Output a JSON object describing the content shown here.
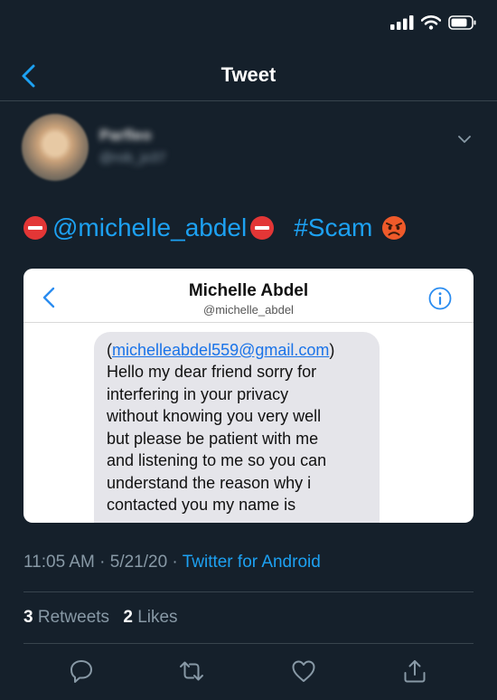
{
  "nav": {
    "title": "Tweet"
  },
  "tweet": {
    "mention": "@michelle_abdel",
    "hashtag": "#Scam",
    "timestamp": "11:05 AM · 5/21/20 · ",
    "source": "Twitter for Android",
    "retweets": {
      "count": "3",
      "label": " Retweets"
    },
    "likes": {
      "count": "2",
      "label": " Likes"
    }
  },
  "embed": {
    "name": "Michelle Abdel",
    "handle": "@michelle_abdel",
    "email_open": "(",
    "email": "michelleabdel559@gmail.com",
    "email_close": ")",
    "lines": [
      "Hello my dear friend sorry for",
      "interfering in your privacy",
      "without knowing you very well",
      "but please be patient with me",
      "and listening to me so you can",
      "understand the reason why i",
      "contacted you my name is"
    ]
  },
  "icons": {
    "back": "chevron-left-icon",
    "more": "chevron-down-icon",
    "reply": "reply-icon",
    "retweet": "retweet-icon",
    "like": "heart-icon",
    "share": "share-icon"
  },
  "colors": {
    "background": "#15202b",
    "accent": "#1da1f2",
    "muted": "#8899a6",
    "border": "#38444d"
  }
}
